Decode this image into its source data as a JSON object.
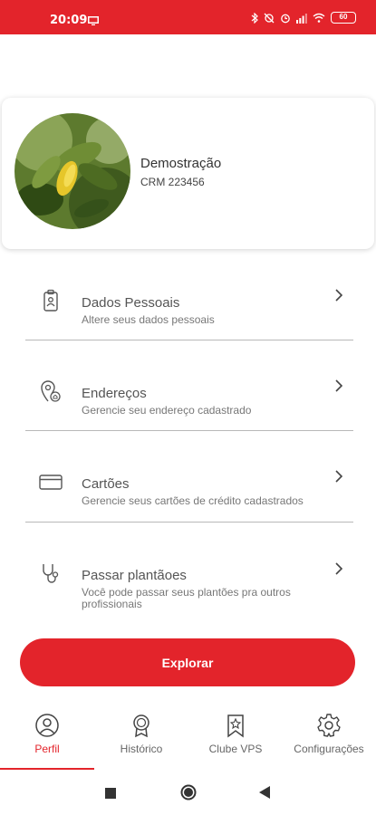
{
  "status_bar": {
    "time": "20:09",
    "battery": "60"
  },
  "profile": {
    "name": "Demostração",
    "crm": "CRM 223456"
  },
  "menu": [
    {
      "title": "Dados Pessoais",
      "subtitle": "Altere seus dados pessoais",
      "icon": "id-badge-icon"
    },
    {
      "title": "Endereços",
      "subtitle": "Gerencie seu endereço cadastrado",
      "icon": "location-pin-icon"
    },
    {
      "title": "Cartões",
      "subtitle": "Gerencie seus cartões de crédito cadastrados",
      "icon": "credit-card-icon"
    },
    {
      "title": "Passar plantãoes",
      "subtitle": "Você pode passar seus plantões pra outros profissionais",
      "icon": "stethoscope-icon"
    }
  ],
  "explore_button": "Explorar",
  "bottom_nav": [
    {
      "label": "Perfil",
      "icon": "person-icon",
      "active": true
    },
    {
      "label": "Histórico",
      "icon": "medal-icon",
      "active": false
    },
    {
      "label": "Clube VPS",
      "icon": "bookmark-star-icon",
      "active": false
    },
    {
      "label": "Configurações",
      "icon": "gear-icon",
      "active": false
    }
  ],
  "colors": {
    "accent": "#e3242b",
    "text": "#555555",
    "divider": "#b8b8b8"
  }
}
